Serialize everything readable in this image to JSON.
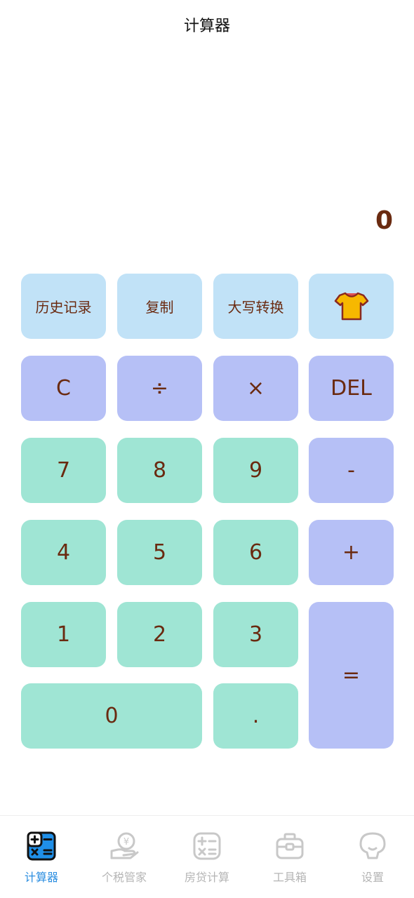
{
  "header": {
    "title": "计算器"
  },
  "display": {
    "value": "0"
  },
  "keys": {
    "history": "历史记录",
    "copy": "复制",
    "uppercase": "大写转换",
    "clear": "C",
    "divide": "÷",
    "multiply": "×",
    "delete": "DEL",
    "seven": "7",
    "eight": "8",
    "nine": "9",
    "minus": "-",
    "four": "4",
    "five": "5",
    "six": "6",
    "plus": "+",
    "one": "1",
    "two": "2",
    "three": "3",
    "equals": "=",
    "zero": "0",
    "dot": "."
  },
  "tabbar": {
    "items": [
      {
        "label": "计算器",
        "icon": "calculator-icon",
        "active": true
      },
      {
        "label": "个税管家",
        "icon": "tax-hand-icon",
        "active": false
      },
      {
        "label": "房贷计算",
        "icon": "calc-grid-icon",
        "active": false
      },
      {
        "label": "工具箱",
        "icon": "toolbox-icon",
        "active": false
      },
      {
        "label": "设置",
        "icon": "settings-face-icon",
        "active": false
      }
    ]
  },
  "colors": {
    "key_blue": "#c1e2f7",
    "key_purple": "#b6c0f6",
    "key_green": "#9fe5d4",
    "key_text": "#6a2a10",
    "tab_active": "#2b8ee0",
    "tab_inactive": "#b5b5b5"
  }
}
